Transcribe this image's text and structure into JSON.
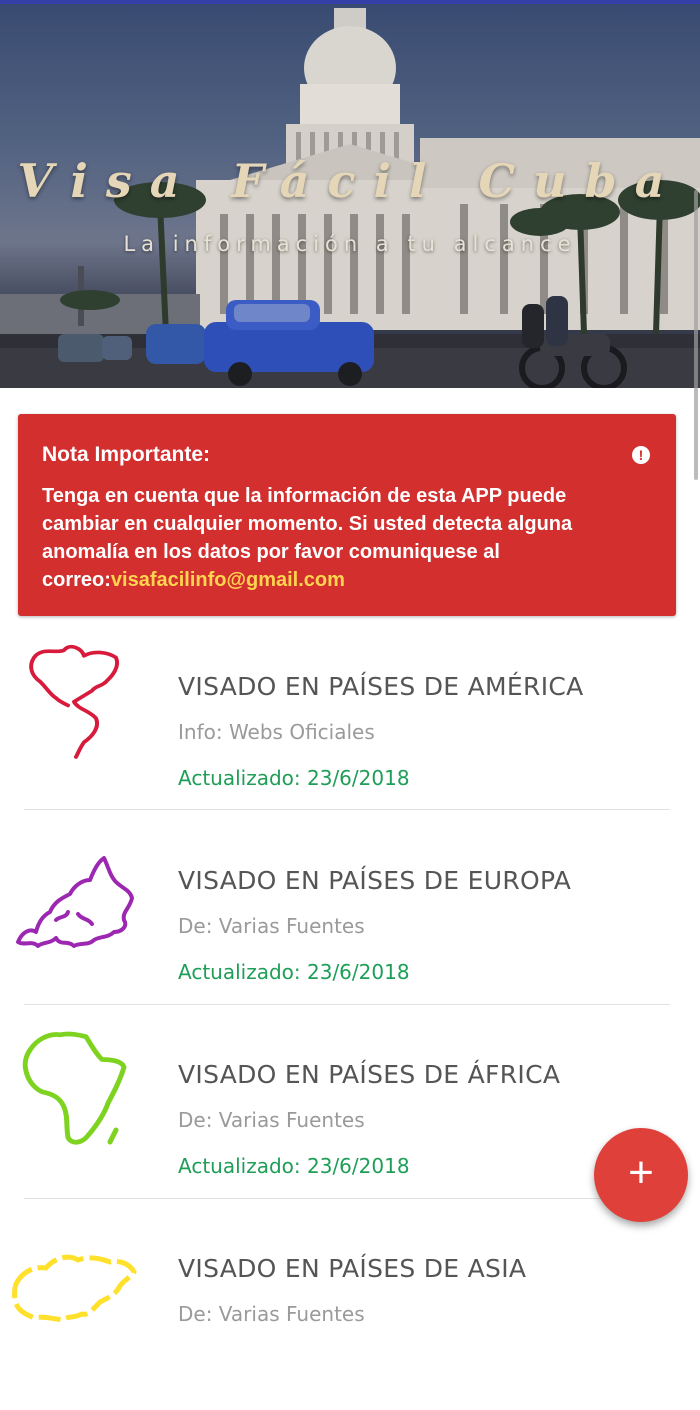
{
  "hero": {
    "title": "Visa Fácil Cuba",
    "subtitle": "La información a tu alcance"
  },
  "note": {
    "title": "Nota Importante:",
    "body": "Tenga en cuenta que la información de esta APP puede cambiar en cualquier momento. Si usted detecta alguna anomalía en los datos por favor comuniquese al correo:",
    "email": "visafacilinfo@gmail.com",
    "icon": "alert-circle-icon",
    "icon_glyph": "!"
  },
  "items": [
    {
      "title": "VISADO EN PAÍSES DE AMÉRICA",
      "subtitle": "Info: Webs Oficiales",
      "updated": "Actualizado: 23/6/2018",
      "icon": "americas-map-icon",
      "color": "#d81b3c"
    },
    {
      "title": "VISADO EN PAÍSES DE EUROPA",
      "subtitle": "De: Varias Fuentes",
      "updated": "Actualizado: 23/6/2018",
      "icon": "europe-map-icon",
      "color": "#9c27b0"
    },
    {
      "title": "VISADO EN PAÍSES DE ÁFRICA",
      "subtitle": "De: Varias Fuentes",
      "updated": "Actualizado: 23/6/2018",
      "icon": "africa-map-icon",
      "color": "#7ed321"
    },
    {
      "title": "VISADO EN PAÍSES DE ASIA",
      "subtitle": "De: Varias Fuentes",
      "updated": "",
      "icon": "asia-map-icon",
      "color": "#ffe02a"
    }
  ],
  "fab": {
    "label": "+",
    "icon": "plus-icon"
  }
}
